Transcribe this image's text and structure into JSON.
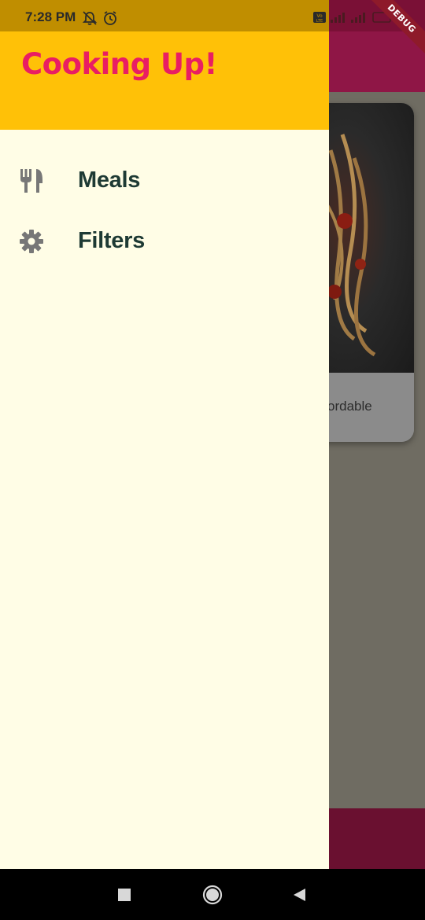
{
  "status_bar": {
    "time": "7:28 PM",
    "left_icons": [
      "notifications-off-icon",
      "alarm-icon"
    ],
    "right_icons": [
      "volte-icon",
      "signal-icon",
      "signal-icon",
      "battery-icon"
    ]
  },
  "debug_banner": "DEBUG",
  "drawer": {
    "title": "Cooking Up!",
    "items": [
      {
        "icon": "restaurant-icon",
        "label": "Meals"
      },
      {
        "icon": "gear-icon",
        "label": "Filters"
      }
    ]
  },
  "background": {
    "meal_card_text": "ordable"
  },
  "colors": {
    "drawer_header": "#ffc107",
    "drawer_background": "#fffde6",
    "title_color": "#e91e63",
    "item_text": "#1e3a34",
    "appbar": "#8f1646"
  },
  "navigation_bar": {
    "buttons": [
      "recent-apps-button",
      "home-button",
      "back-button"
    ]
  }
}
